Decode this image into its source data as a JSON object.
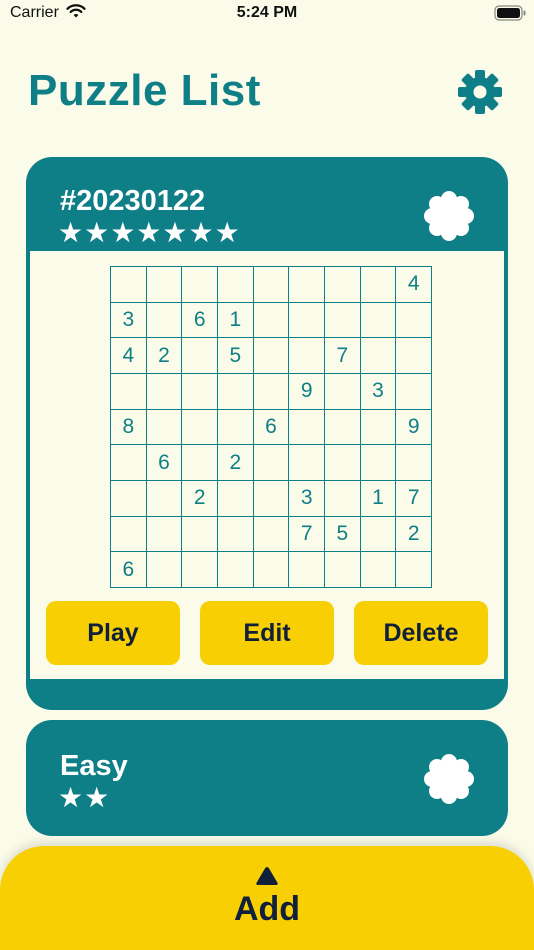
{
  "status_bar": {
    "carrier": "Carrier",
    "time": "5:24 PM"
  },
  "header": {
    "title": "Puzzle List",
    "settings_icon": "gear-icon"
  },
  "puzzles": [
    {
      "title": "#20230122",
      "stars": "★★★★★★★",
      "badge_icon": "badge-icon",
      "grid": [
        [
          "",
          "",
          "",
          "",
          "",
          "",
          "",
          "",
          "4"
        ],
        [
          "3",
          "",
          "6",
          "1",
          "",
          "",
          "",
          "",
          ""
        ],
        [
          "4",
          "2",
          "",
          "5",
          "",
          "",
          "7",
          "",
          ""
        ],
        [
          "",
          "",
          "",
          "",
          "",
          "9",
          "",
          "3",
          ""
        ],
        [
          "8",
          "",
          "",
          "",
          "6",
          "",
          "",
          "",
          "9"
        ],
        [
          "",
          "6",
          "",
          "2",
          "",
          "",
          "",
          "",
          ""
        ],
        [
          "",
          "",
          "2",
          "",
          "",
          "3",
          "",
          "1",
          "7"
        ],
        [
          "",
          "",
          "",
          "",
          "",
          "7",
          "5",
          "",
          "2"
        ],
        [
          "6",
          "",
          "",
          "",
          "",
          "",
          "",
          "",
          ""
        ]
      ],
      "actions": {
        "play": "Play",
        "edit": "Edit",
        "delete": "Delete"
      }
    },
    {
      "title": "Easy",
      "stars": "★★",
      "badge_icon": "badge-icon"
    }
  ],
  "footer": {
    "add_label": "Add",
    "add_icon": "triangle-up-icon"
  },
  "colors": {
    "background": "#fbfbe9",
    "teal": "#0f7f87",
    "yellow": "#f8cf02",
    "navy": "#11203a"
  }
}
